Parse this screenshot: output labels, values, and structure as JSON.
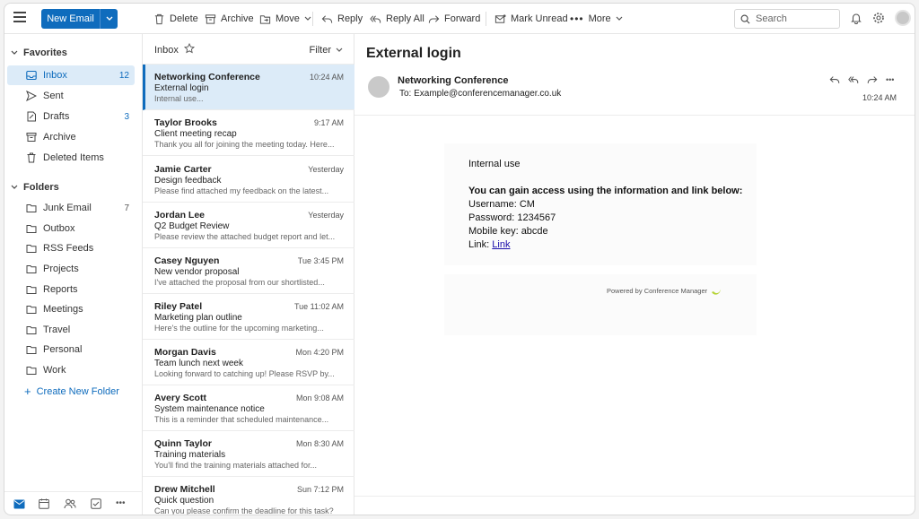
{
  "toolbar": {
    "new_email": "New Email",
    "delete": "Delete",
    "archive": "Archive",
    "move": "Move",
    "reply": "Reply",
    "reply_all": "Reply All",
    "forward": "Forward",
    "mark_unread": "Mark Unread",
    "more": "More",
    "search_placeholder": "Search"
  },
  "sidebar": {
    "favorites_label": "Favorites",
    "folders_label": "Folders",
    "favorites": [
      {
        "label": "Inbox",
        "count": "12",
        "icon": "inbox-icon"
      },
      {
        "label": "Sent",
        "count": "",
        "icon": "send-icon"
      },
      {
        "label": "Drafts",
        "count": "3",
        "icon": "drafts-icon"
      },
      {
        "label": "Archive",
        "count": "",
        "icon": "archive-icon"
      },
      {
        "label": "Deleted Items",
        "count": "",
        "icon": "trash-icon"
      }
    ],
    "folders": [
      {
        "label": "Junk Email",
        "count": "7"
      },
      {
        "label": "Outbox",
        "count": ""
      },
      {
        "label": "RSS Feeds",
        "count": ""
      },
      {
        "label": "Projects",
        "count": ""
      },
      {
        "label": "Reports",
        "count": ""
      },
      {
        "label": "Meetings",
        "count": ""
      },
      {
        "label": "Travel",
        "count": ""
      },
      {
        "label": "Personal",
        "count": ""
      },
      {
        "label": "Work",
        "count": ""
      }
    ],
    "create_folder": "Create New Folder"
  },
  "list": {
    "title": "Inbox",
    "filter": "Filter",
    "messages": [
      {
        "sender": "Networking Conference",
        "time": "10:24 AM",
        "subject": "External login",
        "preview": "Internal use..."
      },
      {
        "sender": "Taylor Brooks",
        "time": "9:17 AM",
        "subject": "Client meeting recap",
        "preview": "Thank you all for joining the meeting today. Here..."
      },
      {
        "sender": "Jamie Carter",
        "time": "Yesterday",
        "subject": "Design feedback",
        "preview": "Please find attached my feedback on the latest..."
      },
      {
        "sender": "Jordan Lee",
        "time": "Yesterday",
        "subject": "Q2 Budget Review",
        "preview": "Please review the attached budget report and let..."
      },
      {
        "sender": "Casey Nguyen",
        "time": "Tue 3:45 PM",
        "subject": "New vendor proposal",
        "preview": "I've attached the proposal from our shortlisted..."
      },
      {
        "sender": "Riley Patel",
        "time": "Tue 11:02 AM",
        "subject": "Marketing plan outline",
        "preview": "Here's the outline for the upcoming marketing..."
      },
      {
        "sender": "Morgan Davis",
        "time": "Mon 4:20 PM",
        "subject": "Team lunch next week",
        "preview": "Looking forward to catching up! Please RSVP by..."
      },
      {
        "sender": "Avery Scott",
        "time": "Mon 9:08 AM",
        "subject": "System maintenance notice",
        "preview": "This is a reminder that scheduled maintenance..."
      },
      {
        "sender": "Quinn Taylor",
        "time": "Mon 8:30 AM",
        "subject": "Training materials",
        "preview": "You'll find the training materials attached for..."
      },
      {
        "sender": "Drew Mitchell",
        "time": "Sun 7:12 PM",
        "subject": "Quick question",
        "preview": "Can you please confirm the deadline for this task?"
      }
    ]
  },
  "reading": {
    "subject": "External login",
    "from": "Networking Conference",
    "to": "To: Example@conferencemanager.co.uk",
    "time": "10:24 AM",
    "body": {
      "line1": "Internal use",
      "heading": "You can gain access using the information and link below:",
      "username": "Username: CM",
      "password": "Password: 1234567",
      "mobile_key": "Mobile key: abcde",
      "link_prefix": "Link: ",
      "link_text": "Link"
    },
    "powered_by": "Powered by Conference Manager"
  },
  "colors": {
    "accent": "#0f6cbd",
    "selected_bg": "#dcebf8"
  }
}
